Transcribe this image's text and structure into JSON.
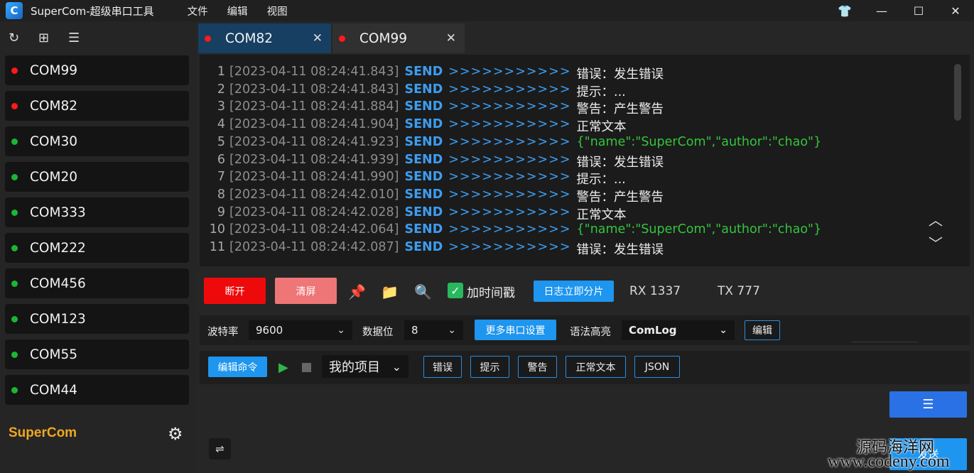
{
  "titlebar": {
    "logo_text": "C",
    "title": "SuperCom-超级串口工具",
    "menu": [
      "文件",
      "编辑",
      "视图"
    ],
    "controls": {
      "theme": "👕",
      "minimize": "—",
      "maximize": "☐",
      "close": "✕"
    }
  },
  "sidebar": {
    "tools": [
      "↻",
      "⊞",
      "☰"
    ],
    "ports": [
      {
        "name": "COM99",
        "status": "red"
      },
      {
        "name": "COM82",
        "status": "red"
      },
      {
        "name": "COM30",
        "status": "green"
      },
      {
        "name": "COM20",
        "status": "green"
      },
      {
        "name": "COM333",
        "status": "green"
      },
      {
        "name": "COM222",
        "status": "green"
      },
      {
        "name": "COM456",
        "status": "green"
      },
      {
        "name": "COM123",
        "status": "green"
      },
      {
        "name": "COM55",
        "status": "green"
      },
      {
        "name": "COM44",
        "status": "green"
      }
    ],
    "brand": "SuperCom",
    "settings_icon": "⚙"
  },
  "tabs": [
    {
      "label": "COM82",
      "active": true,
      "close": "✕"
    },
    {
      "label": "COM99",
      "active": false,
      "close": "✕"
    }
  ],
  "log": {
    "lines": [
      {
        "n": "1",
        "ts": "[2023-04-11 08:24:41.843]",
        "dir": "SEND",
        "arrow": ">>>>>>>>>>>",
        "msg": "错误：发生错误",
        "json": false
      },
      {
        "n": "2",
        "ts": "[2023-04-11 08:24:41.843]",
        "dir": "SEND",
        "arrow": ">>>>>>>>>>>",
        "msg": "提示：...",
        "json": false
      },
      {
        "n": "3",
        "ts": "[2023-04-11 08:24:41.884]",
        "dir": "SEND",
        "arrow": ">>>>>>>>>>>",
        "msg": "警告：产生警告",
        "json": false
      },
      {
        "n": "4",
        "ts": "[2023-04-11 08:24:41.904]",
        "dir": "SEND",
        "arrow": ">>>>>>>>>>>",
        "msg": "正常文本",
        "json": false
      },
      {
        "n": "5",
        "ts": "[2023-04-11 08:24:41.923]",
        "dir": "SEND",
        "arrow": ">>>>>>>>>>>",
        "msg": "{\"name\":\"SuperCom\",\"author\":\"chao\"}",
        "json": true
      },
      {
        "n": "6",
        "ts": "[2023-04-11 08:24:41.939]",
        "dir": "SEND",
        "arrow": ">>>>>>>>>>>",
        "msg": "错误：发生错误",
        "json": false
      },
      {
        "n": "7",
        "ts": "[2023-04-11 08:24:41.990]",
        "dir": "SEND",
        "arrow": ">>>>>>>>>>>",
        "msg": "提示：...",
        "json": false
      },
      {
        "n": "8",
        "ts": "[2023-04-11 08:24:42.010]",
        "dir": "SEND",
        "arrow": ">>>>>>>>>>>",
        "msg": "警告：产生警告",
        "json": false
      },
      {
        "n": "9",
        "ts": "[2023-04-11 08:24:42.028]",
        "dir": "SEND",
        "arrow": ">>>>>>>>>>>",
        "msg": "正常文本",
        "json": false
      },
      {
        "n": "10",
        "ts": "[2023-04-11 08:24:42.064]",
        "dir": "SEND",
        "arrow": ">>>>>>>>>>>",
        "msg": "{\"name\":\"SuperCom\",\"author\":\"chao\"}",
        "json": true
      },
      {
        "n": "11",
        "ts": "[2023-04-11 08:24:42.087]",
        "dir": "SEND",
        "arrow": ">>>>>>>>>>>",
        "msg": "错误：发生错误",
        "json": false
      }
    ],
    "up_icon": "︿",
    "down_icon": "﹀"
  },
  "controls": {
    "disconnect": "断开",
    "clear": "清屏",
    "pin_icon": "📌",
    "folder_icon": "📁",
    "search_icon": "🔍",
    "timestamp_check": "✓",
    "timestamp_label": "加时间戳",
    "split_log": "日志立即分片",
    "rx": "RX 1337",
    "tx": "TX 777"
  },
  "settings": {
    "baud_label": "波特率",
    "baud_value": "9600",
    "databits_label": "数据位",
    "databits_value": "8",
    "more_settings": "更多串口设置",
    "syntax_label": "语法高亮",
    "syntax_value": "ComLog",
    "edit": "编辑"
  },
  "commands": {
    "edit_cmd": "编辑命令",
    "play_icon": "▶",
    "project": "我的项目",
    "buttons": [
      "错误",
      "提示",
      "警告",
      "正常文本",
      "JSON"
    ]
  },
  "input": {
    "wrap_icon": "⇌",
    "wrap_side_icon": "☰",
    "send": "发送"
  },
  "watermark": {
    "line1": "源码海洋网",
    "line2": "www.codeny.com"
  },
  "colors": {
    "port_red": "#ff1a1a",
    "port_green": "#1db534",
    "accent_blue": "#1e95ee",
    "disconnect_red": "#ee0a0a",
    "brand_orange": "#f0a81e"
  }
}
